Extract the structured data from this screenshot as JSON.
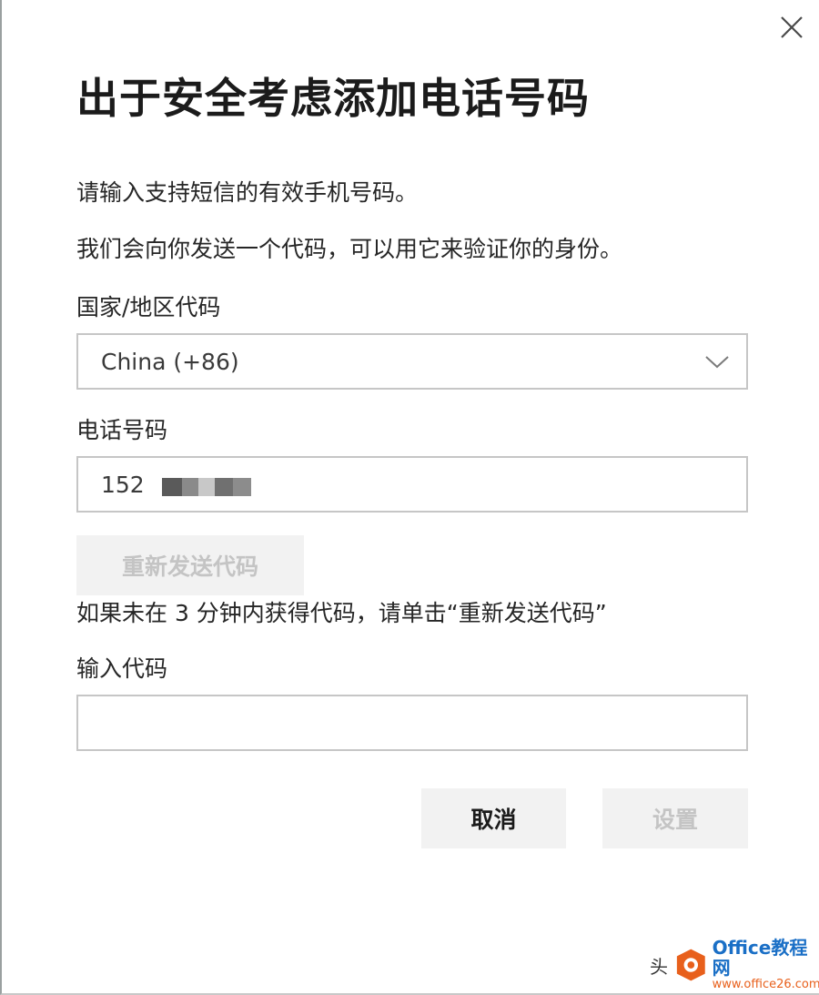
{
  "dialog": {
    "title": "出于安全考虑添加电话号码",
    "close_icon": "close-icon",
    "instruction_1": "请输入支持短信的有效手机号码。",
    "instruction_2": "我们会向你发送一个代码，可以用它来验证你的身份。",
    "country_label": "国家/地区代码",
    "country_value": "China (+86)",
    "phone_label": "电话号码",
    "phone_value": "152",
    "resend_button": "重新发送代码",
    "resend_hint": "如果未在 3 分钟内获得代码，请单击“重新发送代码”",
    "code_label": "输入代码",
    "code_value": "",
    "cancel_button": "取消",
    "set_button": "设置"
  },
  "watermark": {
    "text": "头",
    "brand": "Office教程网",
    "url": "www.office26.com"
  },
  "colors": {
    "title": "#1b1b1b",
    "text": "#262626",
    "border": "#c6c6c6",
    "button_bg": "#f2f2f2",
    "disabled_text": "#c4c4c4"
  }
}
